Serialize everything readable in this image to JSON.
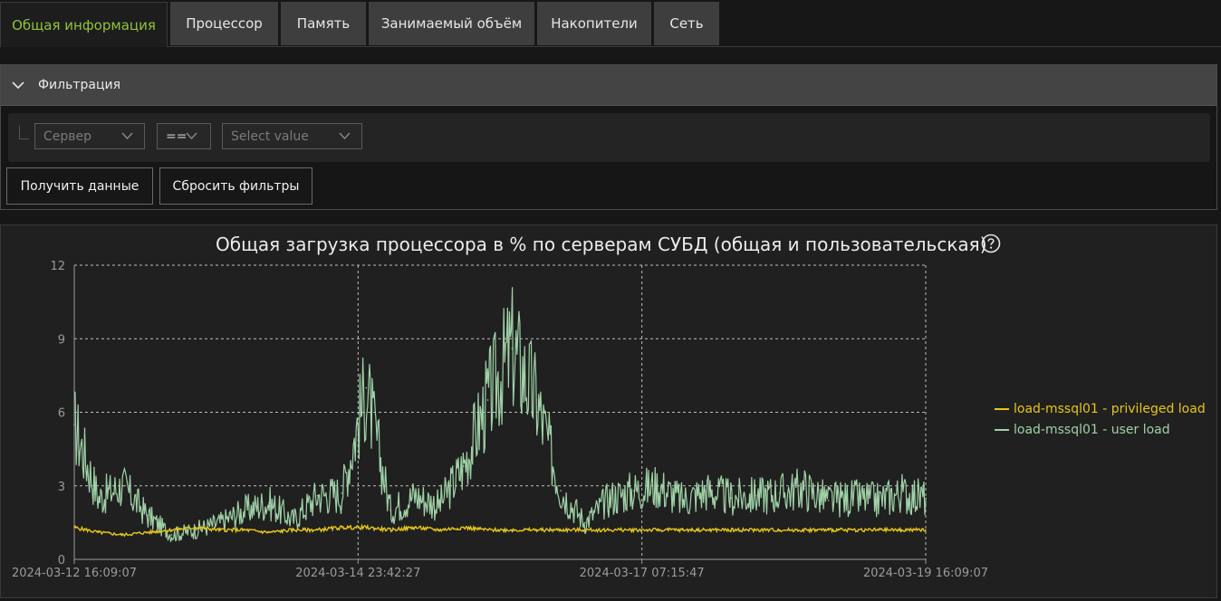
{
  "tabs": [
    {
      "label": "Общая информация",
      "active": true
    },
    {
      "label": "Процессор",
      "active": false
    },
    {
      "label": "Память",
      "active": false
    },
    {
      "label": "Занимаемый объём",
      "active": false
    },
    {
      "label": "Накопители",
      "active": false
    },
    {
      "label": "Сеть",
      "active": false
    }
  ],
  "filter": {
    "title": "Фильтрация",
    "field_placeholder": "Сервер",
    "operator": "==",
    "value_placeholder": "Select value",
    "get_data_label": "Получить данные",
    "reset_label": "Сбросить фильтры"
  },
  "icons": {
    "collapse": "chevron-down-icon",
    "dropdown": "chevron-down-icon",
    "help": "help-circle-icon"
  },
  "colors": {
    "active_tab": "#8fc43a",
    "privileged": "#e6c619",
    "user": "#9fd1a6"
  },
  "chart_data": {
    "type": "line",
    "title": "Общая загрузка процессора в % по серверам СУБД (общая и пользовательская)",
    "xlabel": "",
    "ylabel": "",
    "ylim": [
      0,
      12
    ],
    "y_ticks": [
      0,
      3,
      6,
      9,
      12
    ],
    "x_tick_labels": [
      "2024-03-12 16:09:07",
      "2024-03-14 23:42:27",
      "2024-03-17 07:15:47",
      "2024-03-19 16:09:07"
    ],
    "x": [
      0,
      0.2,
      0.4,
      0.6,
      0.8,
      1.0,
      1.2,
      1.4,
      1.6,
      1.8,
      2.0,
      2.2,
      2.4,
      2.6,
      2.8,
      3.0,
      3.2,
      3.4,
      3.6,
      3.8,
      4.0,
      4.2,
      4.4,
      4.6,
      4.8,
      5.0,
      5.2,
      5.4,
      5.6,
      5.8,
      6.0,
      6.2,
      6.4,
      6.6,
      6.8,
      7.0
    ],
    "series": [
      {
        "name": "load-mssql01 - privileged load",
        "color": "#e6c619",
        "values": [
          1.3,
          1.1,
          1.0,
          1.1,
          1.2,
          1.3,
          1.2,
          1.2,
          1.1,
          1.2,
          1.2,
          1.3,
          1.3,
          1.2,
          1.3,
          1.2,
          1.3,
          1.2,
          1.2,
          1.2,
          1.2,
          1.2,
          1.2,
          1.2,
          1.2,
          1.2,
          1.2,
          1.2,
          1.2,
          1.2,
          1.2,
          1.2,
          1.2,
          1.2,
          1.2,
          1.2
        ]
      },
      {
        "name": "load-mssql01 - user load",
        "color": "#9fd1a6",
        "values": [
          5.5,
          2.5,
          3.0,
          1.8,
          1.0,
          1.2,
          1.5,
          2.0,
          2.3,
          1.6,
          2.6,
          2.7,
          7.0,
          2.0,
          2.6,
          2.2,
          3.8,
          6.5,
          8.6,
          6.5,
          2.8,
          1.5,
          2.5,
          2.8,
          3.0,
          2.4,
          2.8,
          2.5,
          2.6,
          2.7,
          2.9,
          2.4,
          2.5,
          2.4,
          2.7,
          2.5
        ]
      }
    ],
    "legend_position": "right",
    "grid": true
  }
}
